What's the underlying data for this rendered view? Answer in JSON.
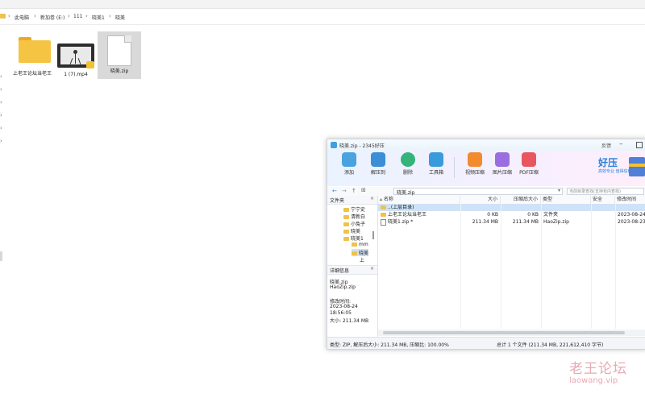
{
  "explorer": {
    "breadcrumb": [
      "此电脑",
      "新加卷 (E:)",
      "111",
      "晓美1",
      "晓美"
    ],
    "files": [
      {
        "name": "上老王论坛当老王",
        "icon": "folder-icon"
      },
      {
        "name": "1 (7).mp4",
        "icon": "video-file-icon"
      },
      {
        "name": "晓美.zip",
        "icon": "zip-file-icon"
      }
    ]
  },
  "haozip": {
    "title": "晓美.zip - 2345好压",
    "feedback": "反馈",
    "toolbar": [
      {
        "label": "添加",
        "icon": "add-icon",
        "color": "#4aa3df"
      },
      {
        "label": "解压到",
        "icon": "extract-icon",
        "color": "#3c8fd6"
      },
      {
        "label": "删除",
        "icon": "delete-icon",
        "color": "#34b37a"
      },
      {
        "label": "工具箱",
        "icon": "toolbox-icon",
        "color": "#3a9bdc"
      },
      {
        "label": "视频压缩",
        "icon": "video-compress-icon",
        "color": "#f28a2e"
      },
      {
        "label": "图片压缩",
        "icon": "image-compress-icon",
        "color": "#9a6ee0"
      },
      {
        "label": "PDF压缩",
        "icon": "pdf-compress-icon",
        "color": "#e8565f"
      }
    ],
    "brand": {
      "name": "好压",
      "slogan": "高效专业 值得信赖"
    },
    "path": "晓美.zip",
    "search_placeholder": "当前目录查找(支持包内查找)",
    "left_panel": {
      "title": "文件夹",
      "tree": [
        "宁宁史",
        "清新白",
        "小兔子",
        "晓美",
        "晓美1",
        "mm",
        "晓美",
        "上"
      ],
      "details_title": "详细信息",
      "details": [
        "晓美.zip",
        "HaoZip.zip",
        "",
        "修改时间:",
        "2023-08-24",
        "18:56:05",
        "大小: 211.34 MB"
      ]
    },
    "columns": [
      "名称",
      "大小",
      "压缩后大小",
      "类型",
      "安全",
      "修改时间"
    ],
    "rows": [
      {
        "name": "..(上层目录)",
        "size": "",
        "packed": "",
        "type": "",
        "security": "",
        "modified": ""
      },
      {
        "name": "上老王论坛当老王",
        "size": "0 KB",
        "packed": "0 KB",
        "type": "文件夹",
        "security": "",
        "modified": "2023-08-24"
      },
      {
        "name": "晓美1.zip *",
        "size": "211.34 MB",
        "packed": "211.34 MB",
        "type": "HaoZip.zip",
        "security": "",
        "modified": "2023-08-23"
      }
    ],
    "status_left": "类型: ZIP, 解压后大小: 211.34 MB, 压缩比: 100.00%",
    "status_right": "总计 1 个文件 (211.34 MB, 221,612,410 字节)"
  },
  "watermark": {
    "text": "老王论坛",
    "url": "laowang.vip"
  }
}
